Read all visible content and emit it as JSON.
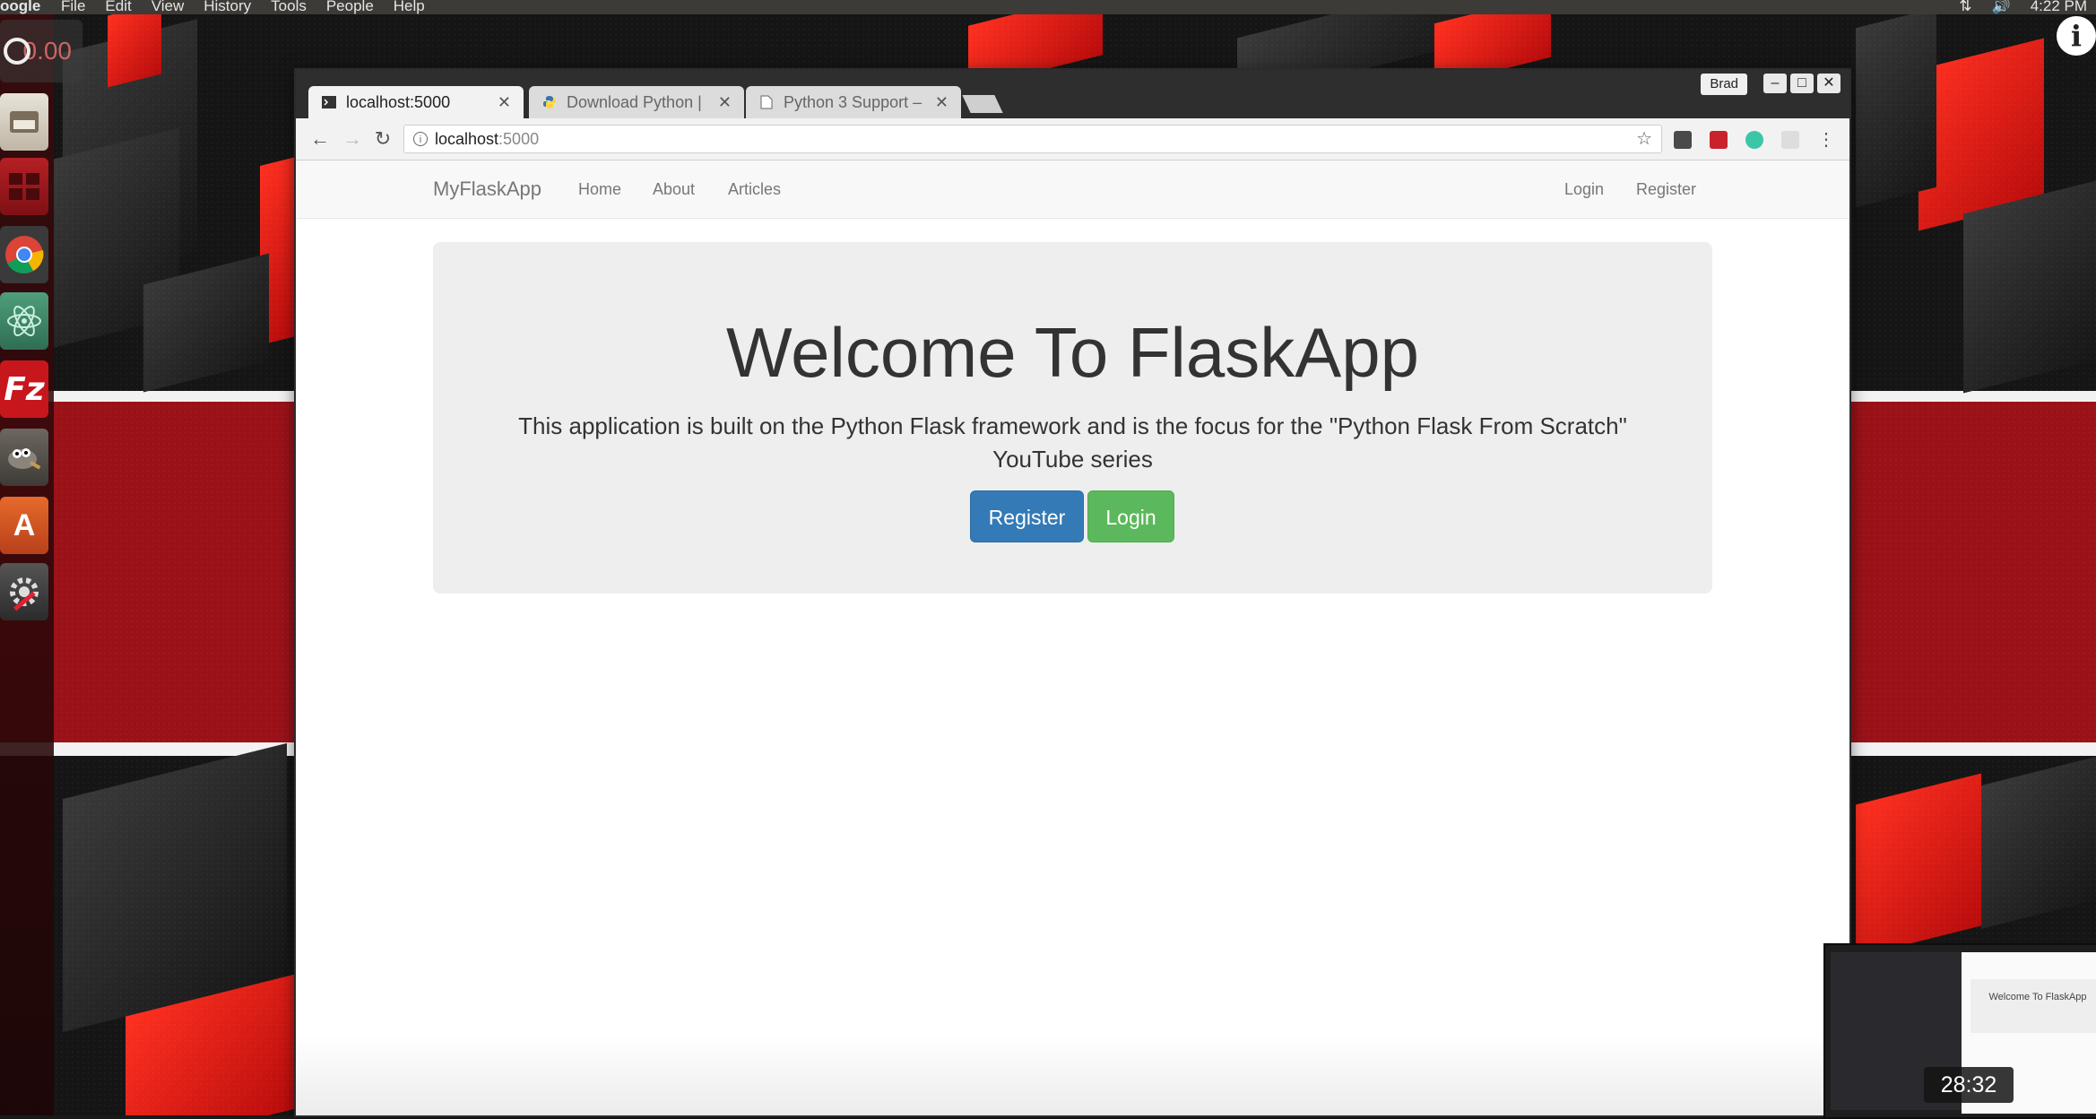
{
  "menubar": {
    "app_name": "oogle",
    "menus": [
      "File",
      "Edit",
      "View",
      "History",
      "Tools",
      "People",
      "Help"
    ],
    "clock": "4:22 PM"
  },
  "overlay": {
    "timer": "0.00"
  },
  "launcher": {
    "apps": [
      "files",
      "workspace-switcher",
      "chrome",
      "atom",
      "filezilla",
      "gimp",
      "software-center",
      "system-settings"
    ]
  },
  "browser": {
    "profile_name": "Brad",
    "tabs": [
      {
        "title": "localhost:5000",
        "favicon": "terminal-icon"
      },
      {
        "title": "Download Python |",
        "favicon": "python-icon"
      },
      {
        "title": "Python 3 Support –",
        "favicon": "document-icon"
      }
    ],
    "address": {
      "host": "localhost",
      "port": ":5000"
    }
  },
  "site": {
    "brand": "MyFlaskApp",
    "nav_left": [
      "Home",
      "About",
      "Articles"
    ],
    "nav_right": [
      "Login",
      "Register"
    ],
    "jumbotron": {
      "title": "Welcome To FlaskApp",
      "text": "This application is built on the Python Flask framework and is the focus for the \"Python Flask From Scratch\" YouTube series",
      "register_button": "Register",
      "login_button": "Login"
    }
  },
  "video": {
    "duration": "28:32",
    "thumbnail_title": "Welcome To FlaskApp"
  },
  "colors": {
    "primary": "#337ab7",
    "success": "#5cb85c",
    "jumbotron_bg": "#eeeeee",
    "navbar_bg": "#f8f8f8",
    "wallpaper_red": "#9a1218"
  }
}
